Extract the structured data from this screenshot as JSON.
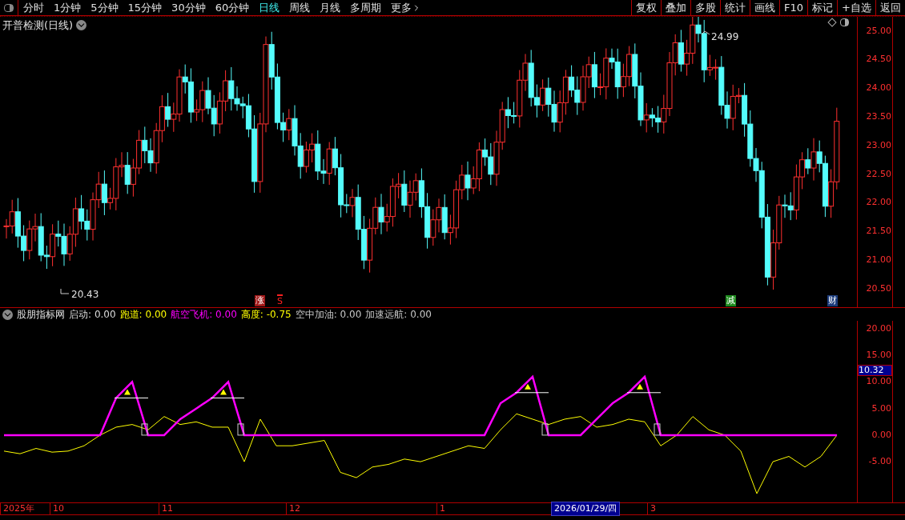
{
  "top_bar": {
    "periods": [
      {
        "label": "分时",
        "selected": false
      },
      {
        "label": "1分钟",
        "selected": false
      },
      {
        "label": "5分钟",
        "selected": false
      },
      {
        "label": "15分钟",
        "selected": false
      },
      {
        "label": "30分钟",
        "selected": false
      },
      {
        "label": "60分钟",
        "selected": false
      },
      {
        "label": "日线",
        "selected": true
      },
      {
        "label": "周线",
        "selected": false
      },
      {
        "label": "月线",
        "selected": false
      },
      {
        "label": "多周期",
        "selected": false
      },
      {
        "label": "更多",
        "selected": false
      }
    ],
    "buttons": [
      "复权",
      "叠加",
      "多股",
      "统计",
      "画线",
      "F10",
      "标记",
      "+自选",
      "返回"
    ]
  },
  "main_chart": {
    "title": "开普检测(日线)",
    "price_ticks": [
      "25.00",
      "24.50",
      "24.00",
      "23.50",
      "23.00",
      "22.50",
      "22.00",
      "21.50",
      "21.00",
      "20.50"
    ],
    "high_label": "24.99",
    "low_label": "20.43",
    "signals": [
      {
        "text": "涨",
        "kind": "badge",
        "color": "#a01818"
      },
      {
        "text": "S",
        "kind": "arrow",
        "color": "#ff2020"
      },
      {
        "text": "减",
        "kind": "badge",
        "color": "#1e8a1e"
      },
      {
        "text": "财",
        "kind": "badge",
        "color": "#1c3c7c"
      }
    ]
  },
  "indicator": {
    "title": "股朋指标网",
    "values": [
      {
        "label": "启动:",
        "value": "0.00",
        "color": "#dcdcdc"
      },
      {
        "label": "跑道:",
        "value": "0.00",
        "color": "#ffff00"
      },
      {
        "label": "航空飞机:",
        "value": "0.00",
        "color": "#ff00ff"
      },
      {
        "label": "高度:",
        "value": "-0.75",
        "color": "#ffff00"
      },
      {
        "label": "空中加油:",
        "value": "0.00",
        "color": "#c8c8c8"
      },
      {
        "label": "加速远航:",
        "value": "0.00",
        "color": "#c8c8c8"
      }
    ],
    "current": "10.32",
    "chart_data": {
      "type": "line",
      "ylim": [
        -12.5,
        21.5
      ],
      "yticks": [
        {
          "value": 20,
          "label": "20.00"
        },
        {
          "value": 15,
          "label": "15.00"
        },
        {
          "value": 10,
          "label": "10.00"
        },
        {
          "value": 5,
          "label": "5.00"
        },
        {
          "value": 0,
          "label": "0.00"
        },
        {
          "value": -5,
          "label": "-5.00"
        }
      ],
      "series": [
        {
          "color": "#ffff00",
          "values": [
            -3,
            -3.5,
            -2.5,
            -3.2,
            -3,
            -2,
            0,
            1.5,
            2,
            1,
            3.5,
            2,
            2.5,
            1.5,
            1.5,
            -5,
            3,
            -2,
            -2,
            -1.5,
            -1,
            -7,
            -8,
            -6,
            -5.5,
            -4.5,
            -5,
            -4,
            -3,
            -2,
            -2.5,
            1,
            4,
            3,
            2,
            3,
            3.5,
            1.5,
            2,
            3,
            2.5,
            -2,
            0,
            3.5,
            1,
            0,
            -3,
            -11,
            -5,
            -4,
            -6,
            -4,
            0
          ]
        },
        {
          "color": "#ff00ff",
          "values": [
            0,
            0,
            0,
            0,
            0,
            0,
            0,
            7,
            10,
            0,
            0,
            3,
            5,
            7,
            10,
            0,
            0,
            0,
            0,
            0,
            0,
            0,
            0,
            0,
            0,
            0,
            0,
            0,
            0,
            0,
            0,
            6,
            8,
            11,
            0,
            0,
            0,
            3,
            6,
            8,
            11,
            0,
            0,
            0,
            0,
            0,
            0,
            0,
            0,
            0,
            0,
            0,
            0
          ]
        }
      ]
    }
  },
  "time_axis": {
    "labels": [
      {
        "text": "2025年",
        "selected": false
      },
      {
        "text": "10",
        "selected": false
      },
      {
        "text": "11",
        "selected": false
      },
      {
        "text": "12",
        "selected": false
      },
      {
        "text": "1",
        "selected": false
      },
      {
        "text": "2026/01/29/四",
        "selected": true
      },
      {
        "text": "3",
        "selected": false
      }
    ]
  }
}
